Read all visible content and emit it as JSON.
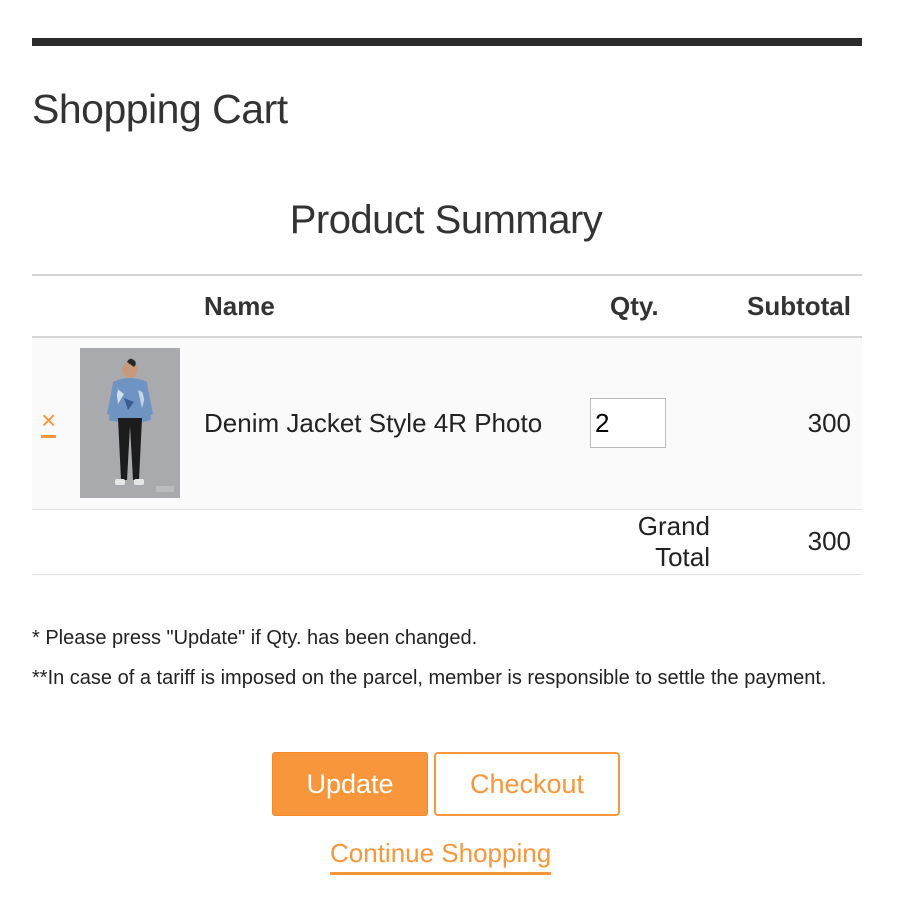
{
  "page": {
    "title": "Shopping Cart"
  },
  "summary": {
    "title": "Product Summary"
  },
  "table": {
    "headers": {
      "name": "Name",
      "qty": "Qty.",
      "subtotal": "Subtotal"
    },
    "items": [
      {
        "remove_icon": "×",
        "image_alt": "Denim Jacket Style 4R Photo",
        "name": "Denim Jacket Style 4R Photo",
        "qty": "2",
        "subtotal": "300"
      }
    ],
    "grand_total": {
      "label": "Grand Total",
      "value": "300"
    }
  },
  "notes": [
    "* Please press \"Update\" if Qty. has been changed.",
    "**In case of a tariff is imposed on the parcel, member is responsible to settle the payment."
  ],
  "actions": {
    "update": "Update",
    "checkout": "Checkout",
    "continue": "Continue Shopping"
  },
  "colors": {
    "accent": "#f7963a",
    "rule": "#2b2b2b"
  }
}
